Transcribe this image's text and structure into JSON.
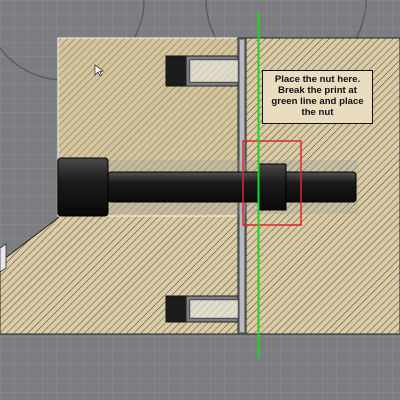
{
  "annotation": {
    "lines": [
      "Place the nut here.",
      "Break the print at",
      "green line and place",
      "the nut"
    ]
  },
  "colors": {
    "background": "#7b7d80",
    "section_fill": "#d9cca6",
    "hatch": "#3a3328",
    "selection_overlay": "#c8b88a",
    "bolt": "#1a1a1a",
    "break_line": "#1fd61f",
    "nut_highlight_box": "#e0262a"
  },
  "icons": {
    "cursor": "mouse-pointer-icon"
  }
}
